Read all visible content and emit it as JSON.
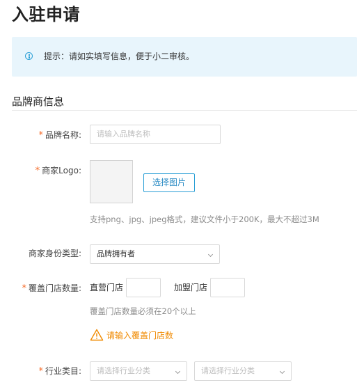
{
  "page": {
    "title": "入驻申请"
  },
  "tip": {
    "text": "提示：请如实填写信息，便于小二审核。"
  },
  "section": {
    "title": "品牌商信息"
  },
  "brand_name": {
    "label": "品牌名称:",
    "placeholder": "请输入品牌名称",
    "value": ""
  },
  "logo": {
    "label": "商家Logo:",
    "button": "选择图片",
    "hint": "支持png、jpg、jpeg格式，建议文件小于200K，最大不超过3M"
  },
  "identity": {
    "label": "商家身份类型:",
    "selected": "品牌拥有者"
  },
  "stores": {
    "label": "覆盖门店数量:",
    "direct_label": "直营门店",
    "direct_value": "",
    "franchise_label": "加盟门店",
    "franchise_value": "",
    "hint": "覆盖门店数量必须在20个以上",
    "error": "请输入覆盖门店数"
  },
  "industry": {
    "label": "行业类目:",
    "placeholder_1": "请选择行业分类",
    "placeholder_2": "请选择行业分类"
  },
  "colors": {
    "accent": "#2a9fd6",
    "required": "#f56c2a",
    "warning": "#f08a00",
    "tip_bg": "#e8f5fc"
  },
  "icons": {
    "tip": "info-circle-icon",
    "warning": "warning-triangle-icon",
    "select": "chevron-down-icon"
  }
}
